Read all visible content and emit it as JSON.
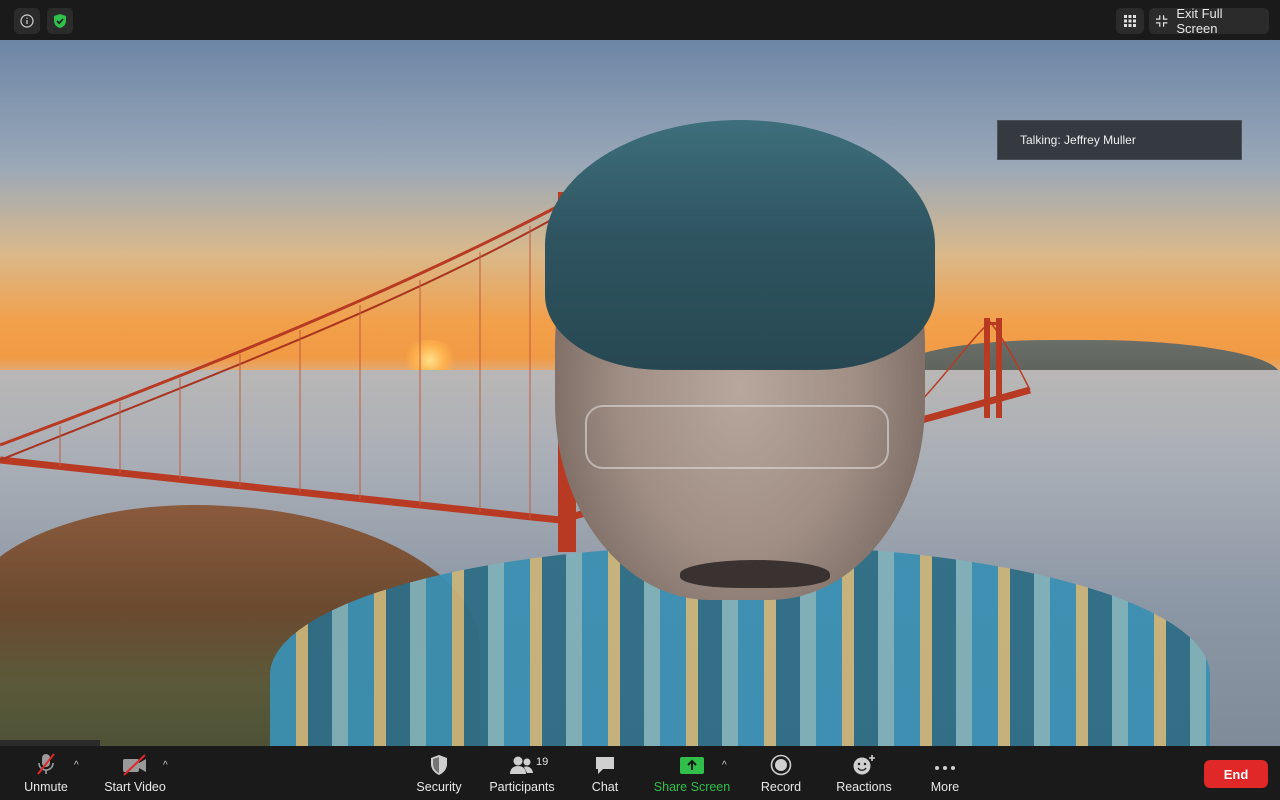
{
  "topbar": {
    "info_icon": "info-icon",
    "security_icon": "shield-check-icon",
    "gallery_icon": "grid-icon",
    "exit_fullscreen_label": "Exit Full Screen",
    "exit_fullscreen_icon": "collapse-icon"
  },
  "video": {
    "talking_label": "Talking: Jeffrey Muller"
  },
  "toolbar": {
    "unmute_label": "Unmute",
    "start_video_label": "Start Video",
    "security_label": "Security",
    "participants_label": "Participants",
    "participants_count": "19",
    "chat_label": "Chat",
    "share_screen_label": "Share Screen",
    "record_label": "Record",
    "reactions_label": "Reactions",
    "more_label": "More",
    "end_label": "End"
  },
  "colors": {
    "toolbar_bg": "#1a1a1a",
    "share_green": "#2fbf4a",
    "end_red": "#e02828",
    "mute_red": "#e02828"
  }
}
